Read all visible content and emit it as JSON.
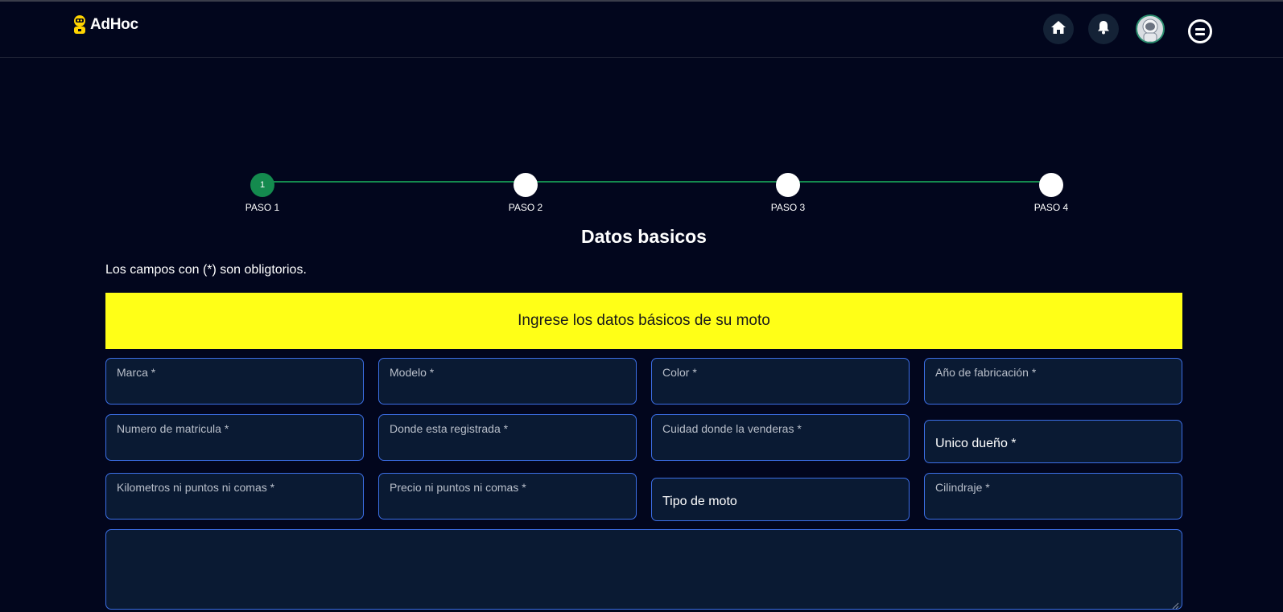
{
  "header": {
    "brand": "AdHoc",
    "icons": [
      "home-icon",
      "bell-icon",
      "avatar",
      "menu-icon"
    ]
  },
  "stepper": {
    "steps": [
      {
        "number": "1",
        "label": "PASO 1",
        "active": true
      },
      {
        "number": "",
        "label": "PASO 2",
        "active": false
      },
      {
        "number": "",
        "label": "PASO 3",
        "active": false
      },
      {
        "number": "",
        "label": "PASO 4",
        "active": false
      }
    ]
  },
  "form": {
    "title": "Datos basicos",
    "required_note": "Los campos con (*) son obligtorios.",
    "banner": "Ingrese los datos básicos de su moto",
    "fields": [
      {
        "label": "Marca *"
      },
      {
        "label": "Modelo *"
      },
      {
        "label": "Color *"
      },
      {
        "label": "Año de fabricación *"
      },
      {
        "label": "Numero de matricula *"
      },
      {
        "label": "Donde esta registrada *"
      },
      {
        "label": "Cuidad donde la venderas *"
      },
      {
        "label": "Unico dueño *"
      },
      {
        "label": "Kilometros ni puntos ni comas *"
      },
      {
        "label": "Precio ni puntos ni comas *"
      },
      {
        "label": "Tipo de moto"
      },
      {
        "label": "Cilindraje *"
      }
    ]
  },
  "colors": {
    "background": "#02061d",
    "accent_green": "#148a4e",
    "banner_yellow": "#ffff17",
    "field_border": "#3c6fe6"
  }
}
